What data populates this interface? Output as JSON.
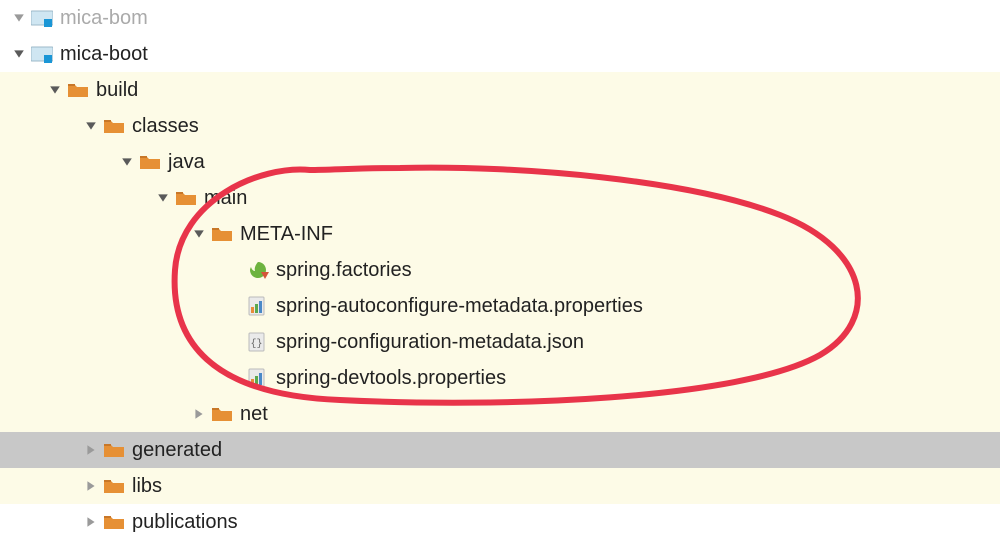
{
  "tree": {
    "nodes": [
      {
        "indent": 0,
        "expanded": true,
        "arrow": "down",
        "iconType": "module",
        "label": "mica-bom",
        "faded": true,
        "rowClass": "top"
      },
      {
        "indent": 0,
        "expanded": true,
        "arrow": "down",
        "iconType": "module",
        "label": "mica-boot",
        "faded": false,
        "rowClass": "top"
      },
      {
        "indent": 1,
        "expanded": true,
        "arrow": "down",
        "iconType": "folder",
        "label": "build",
        "faded": false,
        "rowClass": ""
      },
      {
        "indent": 2,
        "expanded": true,
        "arrow": "down",
        "iconType": "folder",
        "label": "classes",
        "faded": false,
        "rowClass": ""
      },
      {
        "indent": 3,
        "expanded": true,
        "arrow": "down",
        "iconType": "folder",
        "label": "java",
        "faded": false,
        "rowClass": ""
      },
      {
        "indent": 4,
        "expanded": true,
        "arrow": "down",
        "iconType": "folder",
        "label": "main",
        "faded": false,
        "rowClass": ""
      },
      {
        "indent": 5,
        "expanded": true,
        "arrow": "down",
        "iconType": "folder",
        "label": "META-INF",
        "faded": false,
        "rowClass": ""
      },
      {
        "indent": 6,
        "expanded": null,
        "arrow": "none",
        "iconType": "spring",
        "label": "spring.factories",
        "faded": false,
        "rowClass": ""
      },
      {
        "indent": 6,
        "expanded": null,
        "arrow": "none",
        "iconType": "props",
        "label": "spring-autoconfigure-metadata.properties",
        "faded": false,
        "rowClass": ""
      },
      {
        "indent": 6,
        "expanded": null,
        "arrow": "none",
        "iconType": "json",
        "label": "spring-configuration-metadata.json",
        "faded": false,
        "rowClass": ""
      },
      {
        "indent": 6,
        "expanded": null,
        "arrow": "none",
        "iconType": "props",
        "label": "spring-devtools.properties",
        "faded": false,
        "rowClass": ""
      },
      {
        "indent": 5,
        "expanded": false,
        "arrow": "right",
        "iconType": "folder",
        "label": "net",
        "faded": false,
        "rowClass": ""
      },
      {
        "indent": 2,
        "expanded": false,
        "arrow": "right",
        "iconType": "folder",
        "label": "generated",
        "faded": false,
        "rowClass": "highlight"
      },
      {
        "indent": 2,
        "expanded": false,
        "arrow": "right",
        "iconType": "folder",
        "label": "libs",
        "faded": false,
        "rowClass": ""
      },
      {
        "indent": 2,
        "expanded": false,
        "arrow": "right",
        "iconType": "folder",
        "label": "publications",
        "faded": false,
        "rowClass": "bottom"
      }
    ]
  }
}
